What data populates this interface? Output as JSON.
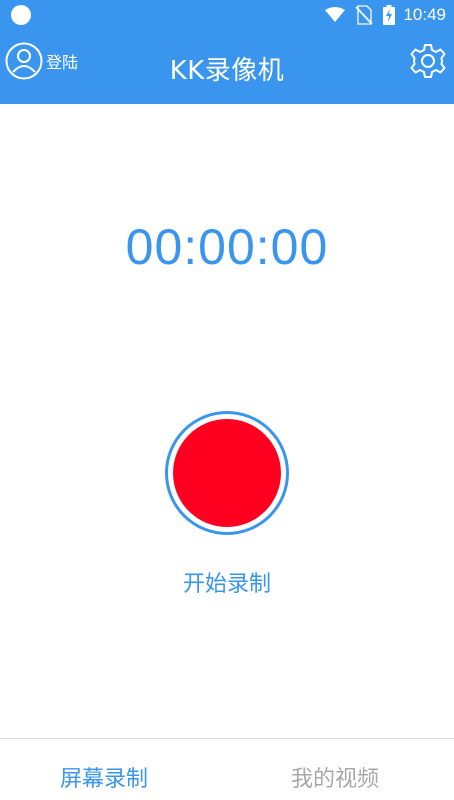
{
  "status_bar": {
    "time": "10:49",
    "icons": [
      "notification-dot-icon",
      "wifi-icon",
      "no-sim-icon",
      "battery-charging-icon"
    ]
  },
  "app_bar": {
    "login_label": "登陆",
    "title": "KK录像机",
    "login_icon": "user-avatar-icon",
    "settings_icon": "gear-icon"
  },
  "main": {
    "timer": "00:00:00",
    "record_label": "开始录制"
  },
  "bottom_nav": {
    "tabs": [
      {
        "label": "屏幕录制",
        "active": true
      },
      {
        "label": "我的视频",
        "active": false
      }
    ]
  },
  "colors": {
    "primary": "#3a95ee",
    "record": "#ff0020",
    "inactive_tab": "#a8a8a8"
  }
}
